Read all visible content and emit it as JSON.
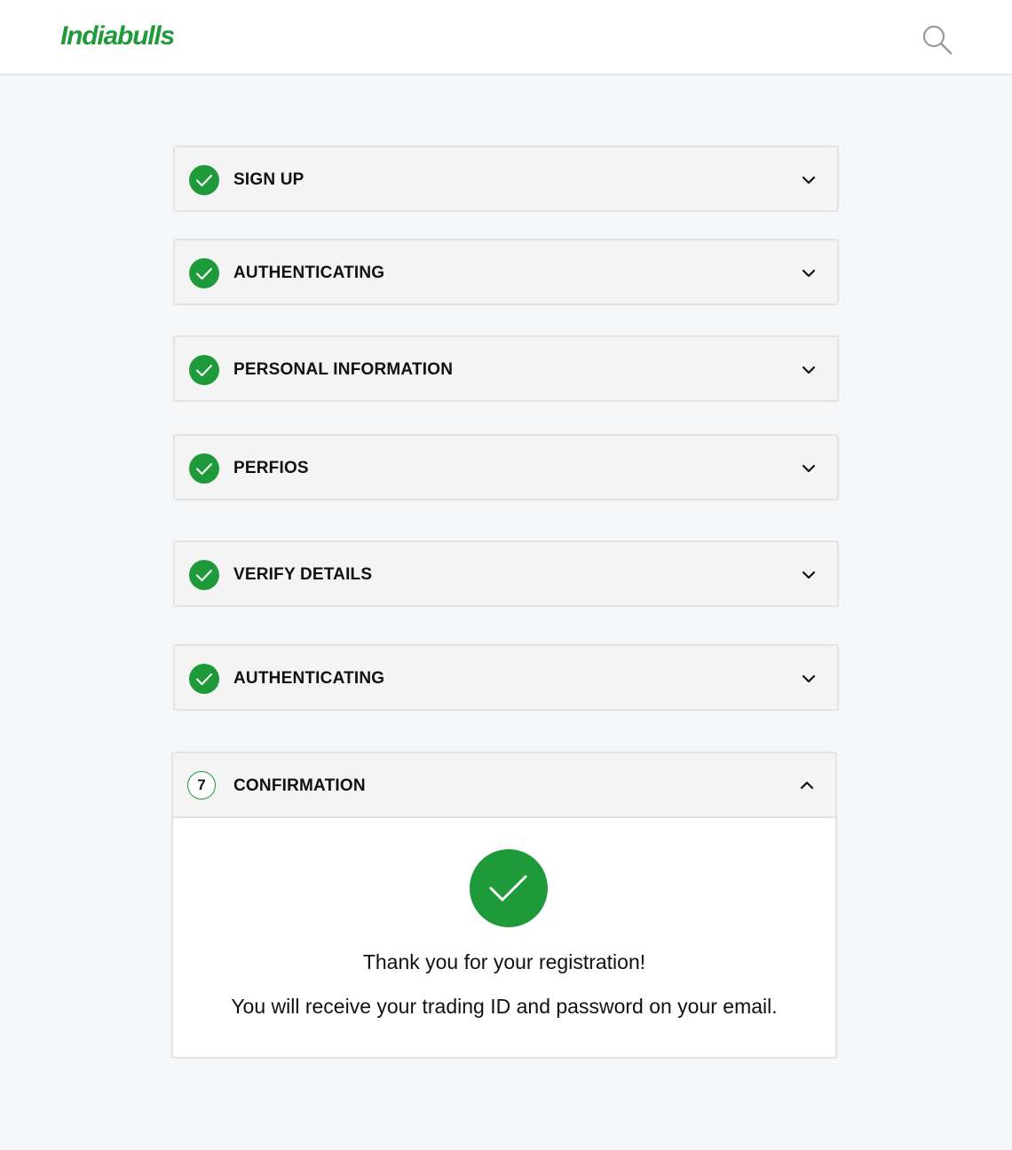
{
  "header": {
    "logo_text": "Indiabulls",
    "search_icon": "search-icon"
  },
  "colors": {
    "brand_green": "#1e9a3a",
    "page_bg": "#f5f6f7",
    "card_bg": "#f4f4f4"
  },
  "steps": [
    {
      "label": "SIGN UP",
      "status": "completed",
      "icon": "check-circle-icon"
    },
    {
      "label": "AUTHENTICATING",
      "status": "completed",
      "icon": "check-circle-icon"
    },
    {
      "label": "PERSONAL INFORMATION",
      "status": "completed",
      "icon": "check-circle-icon"
    },
    {
      "label": "PERFIOS",
      "status": "completed",
      "icon": "check-circle-icon"
    },
    {
      "label": "VERIFY DETAILS",
      "status": "completed",
      "icon": "check-circle-icon"
    },
    {
      "label": "AUTHENTICATING",
      "status": "completed",
      "icon": "check-circle-icon"
    }
  ],
  "active_step": {
    "number": "7",
    "label": "CONFIRMATION",
    "expanded": true,
    "success_icon": "large-check-circle-icon",
    "thank_you": "Thank you for your registration!",
    "info": "You will receive your trading ID and password on your email."
  }
}
